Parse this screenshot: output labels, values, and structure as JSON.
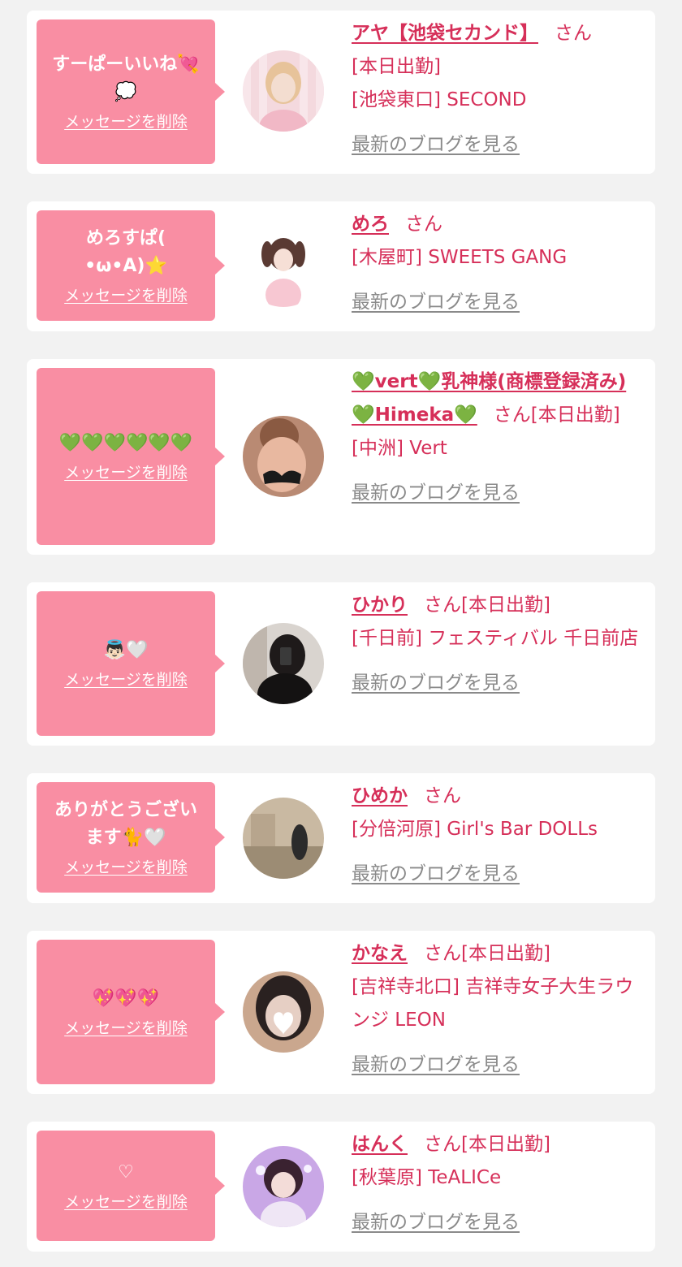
{
  "colors": {
    "page_background": "#f2f2f2",
    "card_background": "#ffffff",
    "bubble": "#f98ea3",
    "accent_text": "#d62f59",
    "link_gray": "#8a8a8a"
  },
  "common": {
    "delete_label": "メッセージを削除",
    "blog_label": "最新のブログを見る",
    "honorific": "さん"
  },
  "entries": [
    {
      "message": "すーぱーいいね💘\n💭",
      "name": "アヤ【池袋セカンド】",
      "after_name": "さん",
      "status": "[本日出勤]",
      "shop": "[池袋東口] SECOND",
      "avatar_icon": "avatar-photo"
    },
    {
      "message": "めろすぱ(\n•ω•А)⭐",
      "name": "めろ",
      "after_name": "さん",
      "status": "",
      "shop": "[木屋町] SWEETS GANG",
      "avatar_icon": "avatar-photo"
    },
    {
      "message": "💚💚💚💚💚💚",
      "name": "💚vert💚乳神様(商標登録済み)💚Himeka💚",
      "after_name": "さん[本日出勤]",
      "status": "",
      "shop": "[中洲] Vert",
      "avatar_icon": "avatar-photo"
    },
    {
      "message": "👼🏻🤍",
      "name": "ひかり",
      "after_name": "さん[本日出勤]",
      "status": "",
      "shop": "[千日前] フェスティバル 千日前店",
      "avatar_icon": "avatar-photo"
    },
    {
      "message": "ありがとうござい\nます🐈🤍",
      "name": "ひめか",
      "after_name": "さん",
      "status": "",
      "shop": "[分倍河原] Girl's Bar DOLLs",
      "avatar_icon": "avatar-photo"
    },
    {
      "message": "💖💖💖",
      "name": "かなえ",
      "after_name": "さん[本日出勤]",
      "status": "",
      "shop": "[吉祥寺北口] 吉祥寺女子大生ラウンジ LEON",
      "avatar_icon": "avatar-photo"
    },
    {
      "message": "♡",
      "name": "はんく",
      "after_name": "さん[本日出勤]",
      "status": "",
      "shop": "[秋葉原] TeALICe",
      "avatar_icon": "avatar-photo"
    }
  ]
}
